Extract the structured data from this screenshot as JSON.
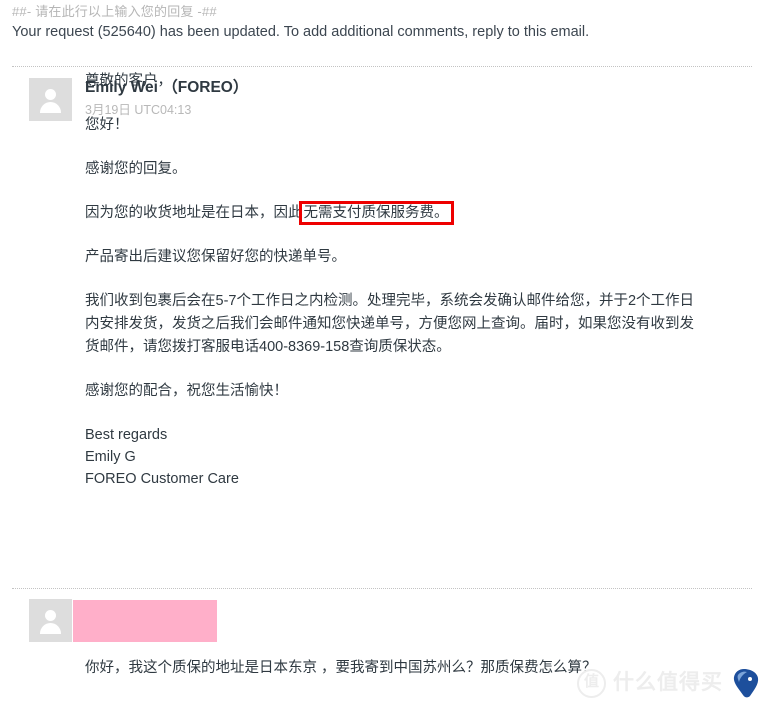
{
  "header": {
    "reply_marker": "##- 请在此行以上输入您的回复 -##",
    "request_line": "Your request (525640) has been updated. To add additional comments, reply to this email."
  },
  "comments": [
    {
      "avatar_icon": "user-avatar-icon",
      "author": "Emily Wei （FOREO）",
      "timestamp": "3月19日 UTC04:13",
      "paragraphs": [
        "尊敬的客户，",
        "您好！",
        "感谢您的回复。"
      ],
      "highlight_paragraph": {
        "before": "因为您的收货地址是在日本，因此",
        "highlighted": "无需支付质保服务费。",
        "highlight_color": "#ee0000"
      },
      "paragraphs_after": [
        "产品寄出后建议您保留好您的快递单号。",
        "我们收到包裹后会在5-7个工作日之内检测。处理完毕，系统会发确认邮件给您，并于2个工作日内安排发货，发货之后我们会邮件通知您快递单号，方便您网上查询。届时，如果您没有收到发货邮件，请您拨打客服电话400-8369-158查询质保状态。",
        "感谢您的配合，祝您生活愉快！"
      ],
      "signature": [
        "Best regards",
        "Emily G",
        "FOREO Customer Care"
      ]
    },
    {
      "avatar_icon": "user-avatar-icon",
      "author_redacted": true,
      "redaction_color": "#ffafc9",
      "message": "你好，我这个质保的地址是日本东京 ，要我寄到中国苏州么？那质保费怎么算？"
    }
  ],
  "watermark": {
    "badge": "值",
    "text": "什么值得买",
    "logo_icon": "smzdm-mascot-icon",
    "color": "#ededed",
    "logo_color": "#1d4f9c"
  }
}
